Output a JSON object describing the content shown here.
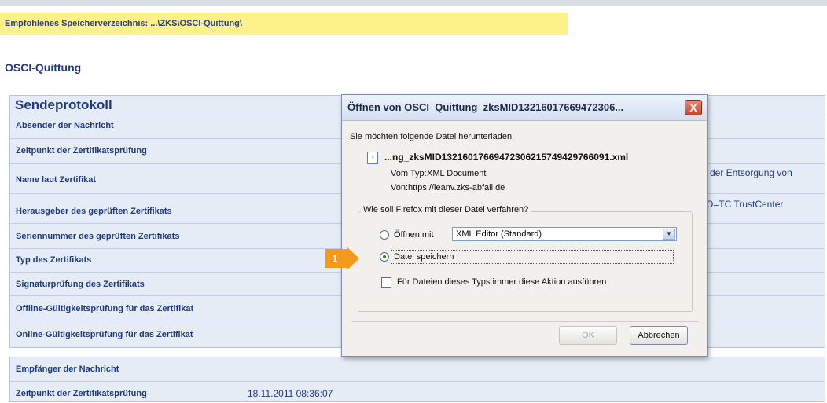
{
  "banner": {
    "text": "Empfohlenes Speicherverzeichnis: ...\\ZKS\\OSCI-Quittung\\"
  },
  "page": {
    "title": "OSCI-Quittung"
  },
  "sendeprotokoll": {
    "title": "Sendeprotokoll",
    "rows": [
      "Absender der Nachricht",
      "Zeitpunkt der Zertifikatsprüfung",
      "Name laut Zertifikat",
      "Herausgeber des geprüften Zertifikats",
      "Seriennummer des geprüften Zertifikats",
      "Typ des Zertifikats",
      "Signaturprüfung des Zertifikats",
      "Offline-Gültigkeitsprüfung für das Zertifikat",
      "Online-Gültigkeitsprüfung für das Zertifikat"
    ],
    "right_values": {
      "name": "der Entsorgung von",
      "issuer": "O=TC TrustCenter"
    }
  },
  "empfaenger": {
    "rows": [
      {
        "label": "Empfänger der Nachricht",
        "value": ""
      },
      {
        "label": "Zeitpunkt der Zertifikatsprüfung",
        "value": "18.11.2011 08:36:07"
      }
    ]
  },
  "dialog": {
    "title": "Öffnen von OSCI_Quittung_zksMID13216017669472306...",
    "close_label": "X",
    "intro": "Sie möchten folgende Datei herunterladen:",
    "filename": "...ng_zksMID13216017669472306215749429766091.xml",
    "type_label": "Vom Typ:",
    "type_value": "XML Document",
    "from_label": "Von:",
    "from_value": "https://leanv.zks-abfall.de",
    "question": "Wie soll Firefox mit dieser Datei verfahren?",
    "option_open": "Öffnen mit",
    "open_with_value": "XML Editor (Standard)",
    "option_save": "Datei speichern",
    "always_label": "Für Dateien dieses Typs immer diese Aktion ausführen",
    "ok_label": "OK",
    "cancel_label": "Abbrechen",
    "selected_option": "save",
    "always_checked": false
  },
  "callout": {
    "number": "1",
    "color": "#f39a1e"
  },
  "colors": {
    "banner": "#fdf28a",
    "section_bg": "#e6ecf6",
    "text_blue": "#1f3a7a"
  }
}
